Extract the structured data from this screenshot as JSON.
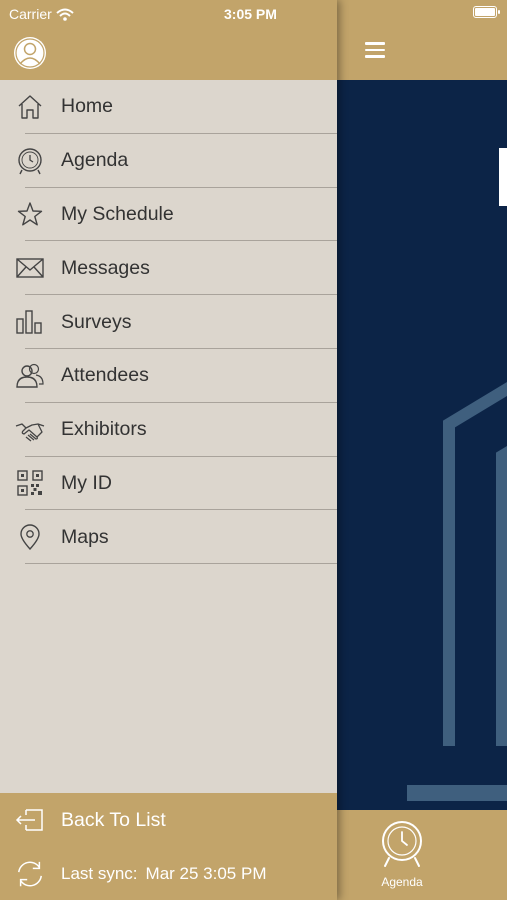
{
  "status_bar": {
    "carrier": "Carrier",
    "time": "3:05 PM",
    "battery_level": 1.0
  },
  "colors": {
    "brand_gold": "#c2a46a",
    "menu_bg": "#dcd6cd",
    "hero_navy": "#0c2447",
    "hero_accent": "#3f5f7e"
  },
  "drawer": {
    "avatar_icon": "user-avatar-icon",
    "menu": [
      {
        "label": "Home",
        "icon": "home-icon"
      },
      {
        "label": "Agenda",
        "icon": "clock-icon"
      },
      {
        "label": "My Schedule",
        "icon": "star-icon"
      },
      {
        "label": "Messages",
        "icon": "envelope-icon"
      },
      {
        "label": "Surveys",
        "icon": "bar-chart-icon"
      },
      {
        "label": "Attendees",
        "icon": "people-icon"
      },
      {
        "label": "Exhibitors",
        "icon": "handshake-icon"
      },
      {
        "label": "My ID",
        "icon": "qr-code-icon"
      },
      {
        "label": "Maps",
        "icon": "map-pin-icon"
      }
    ],
    "footer": {
      "back_label": "Back To List",
      "back_icon": "exit-icon",
      "sync_label": "Last sync:",
      "sync_value": "Mar 25 3:05 PM",
      "sync_icon": "refresh-icon"
    }
  },
  "main": {
    "menu_icon": "hamburger-icon",
    "tab_bar": {
      "items": [
        {
          "label": "Agenda",
          "icon": "clock-icon"
        }
      ]
    }
  }
}
